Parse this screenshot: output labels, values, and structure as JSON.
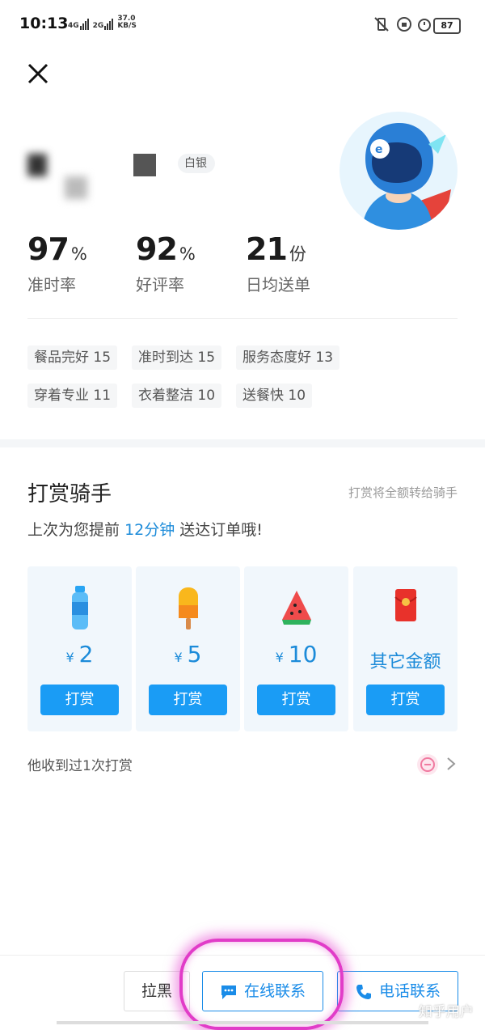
{
  "status_bar": {
    "time": "10:13",
    "net_4g": "4G",
    "net_2g": "2G",
    "speed_value": "37.0",
    "speed_unit": "KB/S",
    "battery": "87"
  },
  "rider": {
    "level": "白银"
  },
  "stats": [
    {
      "value": "97",
      "unit": "%",
      "label": "准时率"
    },
    {
      "value": "92",
      "unit": "%",
      "label": "好评率"
    },
    {
      "value": "21",
      "unit": "份",
      "label": "日均送单"
    }
  ],
  "tags": [
    "餐品完好 15",
    "准时到达 15",
    "服务态度好 13",
    "穿着专业 11",
    "衣着整洁 10",
    "送餐快 10"
  ],
  "tip": {
    "title": "打赏骑手",
    "note": "打赏将全额转给骑手",
    "sub_prefix": "上次为您提前",
    "sub_highlight": "12分钟",
    "sub_suffix": "送达订单哦!",
    "options": [
      {
        "icon": "water-bottle-icon",
        "currency": "¥",
        "amount": "2",
        "button": "打赏"
      },
      {
        "icon": "popsicle-icon",
        "currency": "¥",
        "amount": "5",
        "button": "打赏"
      },
      {
        "icon": "watermelon-icon",
        "currency": "¥",
        "amount": "10",
        "button": "打赏"
      },
      {
        "icon": "red-envelope-icon",
        "amount": "其它金额",
        "button": "打赏"
      }
    ],
    "received": "他收到过1次打赏"
  },
  "bottom_actions": {
    "block": "拉黑",
    "chat": "在线联系",
    "call": "电话联系"
  },
  "watermark": "知乎用户",
  "colors": {
    "accent": "#1a9cf5",
    "highlight_text": "#1c8bd9",
    "annotation": "#e13cc8"
  }
}
